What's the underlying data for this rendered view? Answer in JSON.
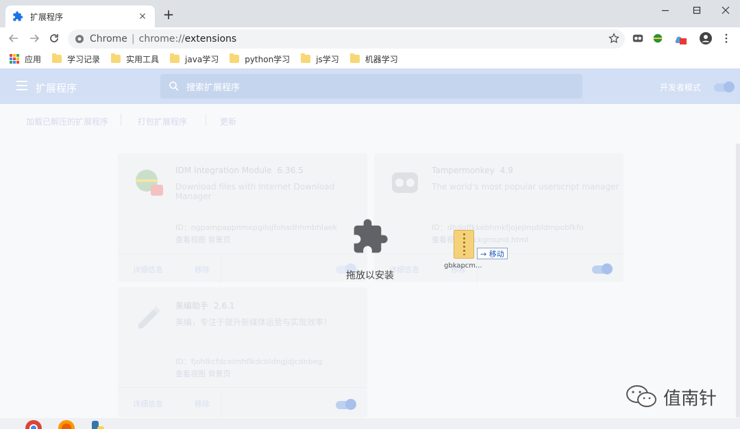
{
  "tab": {
    "title": "扩展程序",
    "close": "×",
    "new_tab": "+"
  },
  "omnibox": {
    "scheme": "Chrome",
    "separator": "|",
    "url_prefix": "chrome://",
    "url_path": "extensions"
  },
  "bookmarks": [
    {
      "label": "应用",
      "kind": "apps"
    },
    {
      "label": "学习记录",
      "kind": "folder"
    },
    {
      "label": "实用工具",
      "kind": "folder"
    },
    {
      "label": "java学习",
      "kind": "folder"
    },
    {
      "label": "python学习",
      "kind": "folder"
    },
    {
      "label": "js学习",
      "kind": "folder"
    },
    {
      "label": "机器学习",
      "kind": "folder"
    }
  ],
  "header": {
    "title": "扩展程序",
    "search_placeholder": "搜索扩展程序",
    "dev_mode": "开发者模式"
  },
  "actions": {
    "load_unpacked": "加载已解压的扩展程序",
    "pack": "打包扩展程序",
    "update": "更新"
  },
  "extensions": [
    {
      "name": "IDM Integration Module",
      "version": "6.36.5",
      "desc": "Download files with Internet Download Manager",
      "id": "ID：ngpampappnmepgilojfohadhhmbhlaek",
      "view": "查看视图",
      "view_link": "背景页",
      "details": "详细信息",
      "remove": "移除"
    },
    {
      "name": "Tampermonkey",
      "version": "4.9",
      "desc": "The world's most popular userscript manager",
      "id": "ID：dhdgffkkebhmkfjojejmpbldmpobfkfo",
      "view": "查看视图",
      "view_link": "background.html",
      "details": "详细信息",
      "remove": "移除"
    },
    {
      "name": "美编助手",
      "version": "2.6.1",
      "desc": "美编，专注于提升新媒体运营与实现效率！",
      "id": "ID：fjohlkcfdceimhflkdcbldngjdjcdnbeg",
      "view": "查看视图",
      "view_link": "背景页",
      "details": "详细信息",
      "remove": "移除"
    }
  ],
  "drop": {
    "label": "拖放以安装"
  },
  "drag": {
    "file_name": "gbkapcm...",
    "tooltip": "→ 移动"
  },
  "watermark": {
    "text": "值南针"
  },
  "colors": {
    "accent": "#1a73e8",
    "header_bg": "#d2dff4",
    "tab_bar": "#dee1e6"
  }
}
